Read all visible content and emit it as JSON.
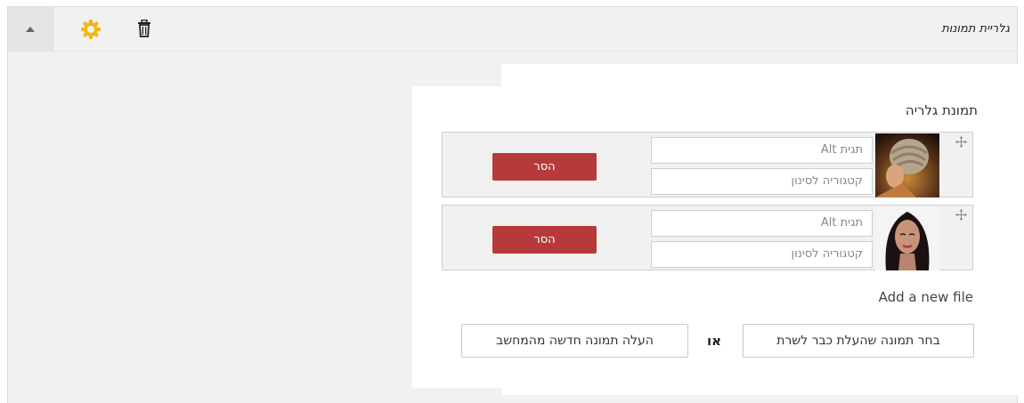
{
  "header": {
    "title": "גלריית תמונות"
  },
  "gallery": {
    "label": "תמונת גלריה",
    "items": [
      {
        "alt_placeholder": "תגית Alt",
        "category_placeholder": "קטגוריה לסינון",
        "remove_label": "הסר",
        "image": "braided-hair-photo"
      },
      {
        "alt_placeholder": "תגית Alt",
        "category_placeholder": "קטגוריה לסינון",
        "remove_label": "הסר",
        "image": "woman-portrait-photo"
      }
    ]
  },
  "add_file": {
    "label": "Add a new file",
    "choose_existing_label": "בחר תמונה שהעלת כבר לשרת",
    "or_label": "או",
    "upload_new_label": "העלה תמונה חדשה מהמחשב"
  },
  "colors": {
    "remove_button": "#b73a3a",
    "gear_icon": "#f2b51a",
    "panel_background": "#f1f1f1"
  }
}
